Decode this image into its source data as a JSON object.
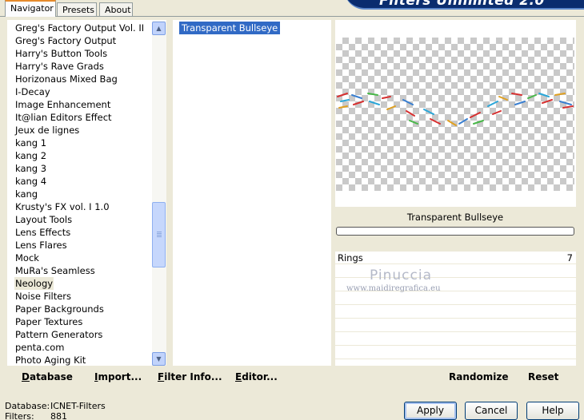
{
  "tabs": [
    {
      "label": "Navigator",
      "active": true
    },
    {
      "label": "Presets",
      "active": false
    },
    {
      "label": "About",
      "active": false
    }
  ],
  "banner_title": "Filters Unlimited 2.0",
  "categories": [
    "Greg's Factory Output Vol. II",
    "Greg's Factory Output",
    "Harry's Button Tools",
    "Harry's Rave Grads",
    "Horizonaus Mixed Bag",
    "I-Decay",
    "Image Enhancement",
    "It@lian Editors Effect",
    "Jeux de lignes",
    "kang 1",
    "kang 2",
    "kang 3",
    "kang 4",
    "kang",
    "Krusty's FX vol. I 1.0",
    "Layout Tools",
    "Lens Effects",
    "Lens Flares",
    "Mock",
    "MuRa's Seamless",
    "Neology",
    "Noise Filters",
    "Paper Backgrounds",
    "Paper Textures",
    "Pattern Generators",
    "penta.com",
    "Photo Aging Kit"
  ],
  "selected_category": "Neology",
  "filters": [
    "Transparent Bullseye"
  ],
  "preview": {
    "filter_name": "Transparent Bullseye",
    "progress": 0
  },
  "parameters": [
    {
      "label": "Rings",
      "value": "7"
    }
  ],
  "watermark": {
    "name": "Pinuccia",
    "url": "www.maidiregrafica.eu"
  },
  "toolbar_left": [
    {
      "label": "Database",
      "underline": "D"
    },
    {
      "label": "Import...",
      "underline": "I"
    },
    {
      "label": "Filter Info...",
      "underline": "F"
    },
    {
      "label": "Editor...",
      "underline": "E"
    }
  ],
  "toolbar_right": {
    "randomize": "Randomize",
    "reset": "Reset"
  },
  "status": {
    "database_label": "Database:",
    "database_value": "ICNET-Filters",
    "filters_label": "Filters:",
    "filters_value": "881"
  },
  "buttons": {
    "apply": "Apply",
    "cancel": "Cancel",
    "help": "Help"
  },
  "colors": {
    "selection": "#316ac5",
    "dialog_bg": "#ece9d8",
    "banner": "#0a2c6e"
  }
}
